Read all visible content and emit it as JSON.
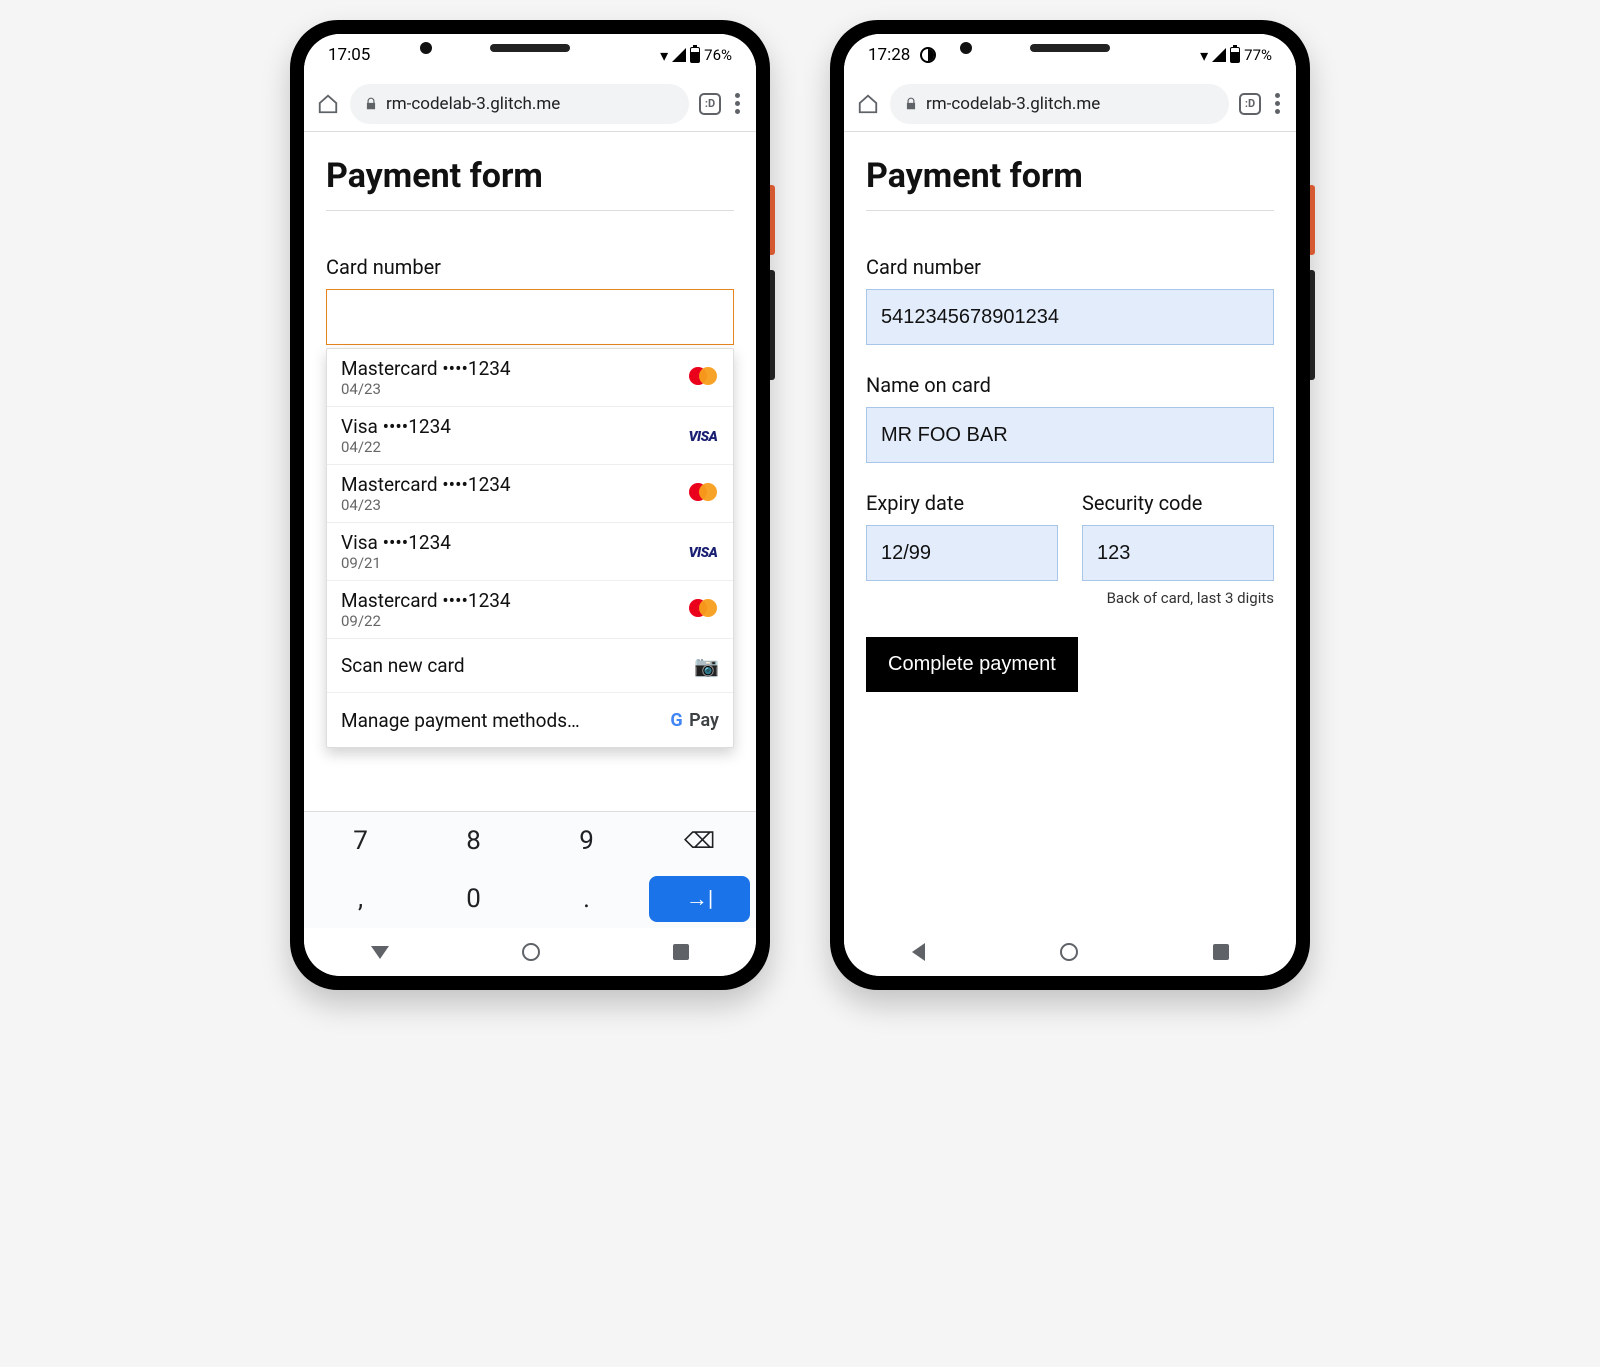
{
  "left": {
    "status": {
      "time": "17:05",
      "battery": "76%"
    },
    "url": "rm-codelab-3.glitch.me",
    "tabs": ":D",
    "title": "Payment form",
    "label_card": "Card number",
    "autofill": [
      {
        "brand": "Mastercard",
        "masked": "••••1234",
        "exp": "04/23",
        "logo": "mc"
      },
      {
        "brand": "Visa",
        "masked": "••••1234",
        "exp": "04/22",
        "logo": "visa"
      },
      {
        "brand": "Mastercard",
        "masked": "••••1234",
        "exp": "04/23",
        "logo": "mc"
      },
      {
        "brand": "Visa",
        "masked": "••••1234",
        "exp": "09/21",
        "logo": "visa"
      },
      {
        "brand": "Mastercard",
        "masked": "••••1234",
        "exp": "09/22",
        "logo": "mc"
      }
    ],
    "scan": "Scan new card",
    "manage": "Manage payment methods…",
    "gpay": "Pay",
    "keys": [
      "7",
      "8",
      "9",
      "⌫",
      ",",
      "0",
      ".",
      "→|"
    ]
  },
  "right": {
    "status": {
      "time": "17:28",
      "battery": "77%"
    },
    "url": "rm-codelab-3.glitch.me",
    "tabs": ":D",
    "title": "Payment form",
    "label_card": "Card number",
    "val_card": "5412345678901234",
    "label_name": "Name on card",
    "val_name": "MR FOO BAR",
    "label_exp": "Expiry date",
    "val_exp": "12/99",
    "label_sec": "Security code",
    "val_sec": "123",
    "hint": "Back of card, last 3 digits",
    "submit": "Complete payment"
  }
}
